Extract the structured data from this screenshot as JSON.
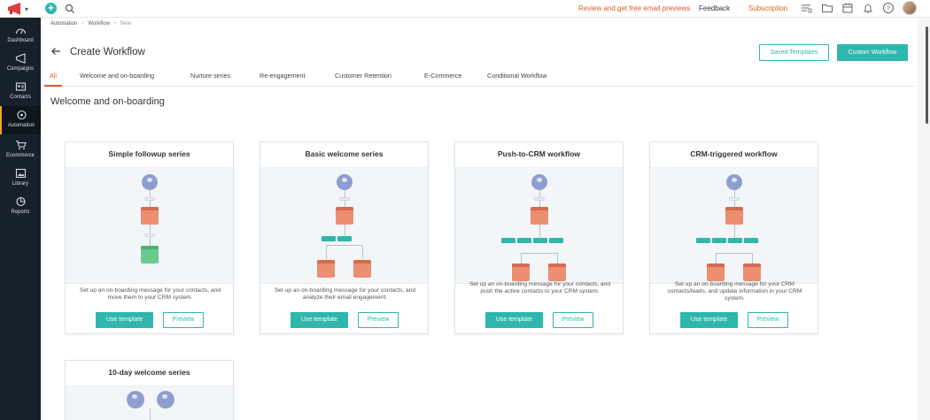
{
  "topbar": {
    "review_link": "Review and get free email previews",
    "feedback": "Feedback",
    "subscription": "Subscription",
    "plus": "+",
    "caret": "▾"
  },
  "sidebar": {
    "items": [
      {
        "label": "Dashboard",
        "icon": "dashboard-icon"
      },
      {
        "label": "Campaigns",
        "icon": "megaphone-icon"
      },
      {
        "label": "Contacts",
        "icon": "contacts-icon"
      },
      {
        "label": "Automation",
        "icon": "automation-icon"
      },
      {
        "label": "Ecommerce",
        "icon": "cart-icon"
      },
      {
        "label": "Library",
        "icon": "library-icon"
      },
      {
        "label": "Reports",
        "icon": "reports-icon"
      }
    ],
    "active": "Automation"
  },
  "breadcrumb": [
    "Automation",
    "Workflow",
    "New"
  ],
  "breadcrumb_sep": "›",
  "page_title": "Create Workflow",
  "buttons": {
    "saved_templates": "Saved Templates",
    "custom_workflow": "Custom Workflow"
  },
  "tabs": [
    "All",
    "Welcome and on-boarding",
    "Nurture series",
    "Re-engagement",
    "Customer Retention",
    "E-Commerce",
    "Conditional Workflow"
  ],
  "active_tab": "All",
  "section_title": "Welcome and on-boarding",
  "cards": [
    {
      "title": "Simple followup series",
      "description": "Set up an on-boarding message for your contacts, and move them to your CRM system.",
      "use_label": "Use template",
      "preview_label": "Preview"
    },
    {
      "title": "Basic welcome series",
      "description": "Set up an on-boarding message for your contacts, and analyze their email engagement.",
      "use_label": "Use template",
      "preview_label": "Preview"
    },
    {
      "title": "Push-to-CRM workflow",
      "description": "Set up an on-boarding message for your contacts, and push the active contacts to your CRM system.",
      "use_label": "Use template",
      "preview_label": "Preview"
    },
    {
      "title": "CRM-triggered workflow",
      "description": "Set up an on-boarding message for your CRM contacts/leads, and update information in your CRM system.",
      "use_label": "Use template",
      "preview_label": "Preview"
    },
    {
      "title": "10-day welcome series"
    }
  ],
  "colors": {
    "accent": "#2fb6ad",
    "orange": "#e05a2a",
    "sidebar": "#17212c",
    "node_trigger": "#8f9ed0",
    "node_email": "#ec8e70",
    "node_crm": "#6bcb8f"
  },
  "back_arrow": "←"
}
